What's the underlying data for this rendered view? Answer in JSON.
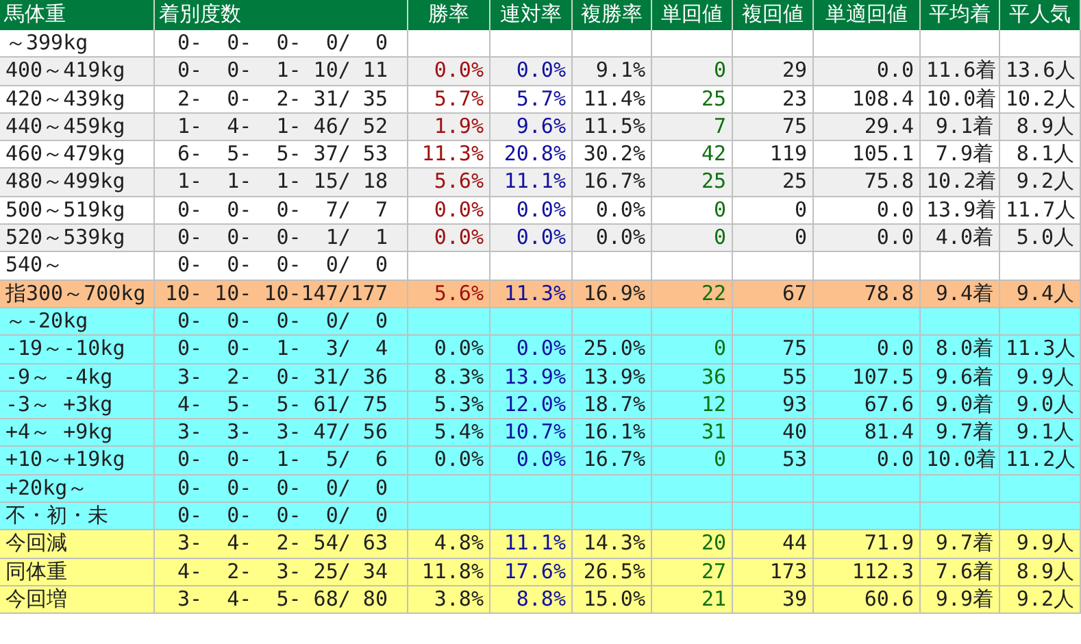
{
  "table": {
    "columns": [
      "馬体重",
      "着別度数",
      "勝率",
      "連対率",
      "複勝率",
      "単回値",
      "複回値",
      "単適回値",
      "平均着",
      "平人気"
    ],
    "rows": [
      {
        "kind": "weight",
        "cells": [
          "～399kg",
          "0-  0-  0-  0/  0",
          null,
          null,
          null,
          null,
          null,
          null,
          null,
          null
        ]
      },
      {
        "kind": "weight",
        "cells": [
          "400～419kg",
          "0-  0-  1- 10/ 11",
          "0.0%",
          "0.0%",
          "9.1%",
          "0",
          "29",
          "0.0",
          "11.6着",
          "13.6人"
        ]
      },
      {
        "kind": "weight",
        "cells": [
          "420～439kg",
          "2-  0-  2- 31/ 35",
          "5.7%",
          "5.7%",
          "11.4%",
          "25",
          "23",
          "108.4",
          "10.0着",
          "10.2人"
        ]
      },
      {
        "kind": "weight",
        "cells": [
          "440～459kg",
          "1-  4-  1- 46/ 52",
          "1.9%",
          "9.6%",
          "11.5%",
          "7",
          "75",
          "29.4",
          "9.1着",
          "8.9人"
        ]
      },
      {
        "kind": "weight",
        "cells": [
          "460～479kg",
          "6-  5-  5- 37/ 53",
          "11.3%",
          "20.8%",
          "30.2%",
          "42",
          "119",
          "105.1",
          "7.9着",
          "8.1人"
        ]
      },
      {
        "kind": "weight",
        "cells": [
          "480～499kg",
          "1-  1-  1- 15/ 18",
          "5.6%",
          "11.1%",
          "16.7%",
          "25",
          "25",
          "75.8",
          "10.2着",
          "9.2人"
        ]
      },
      {
        "kind": "weight",
        "cells": [
          "500～519kg",
          "0-  0-  0-  7/  7",
          "0.0%",
          "0.0%",
          "0.0%",
          "0",
          "0",
          "0.0",
          "13.9着",
          "11.7人"
        ]
      },
      {
        "kind": "weight",
        "cells": [
          "520～539kg",
          "0-  0-  0-  1/  1",
          "0.0%",
          "0.0%",
          "0.0%",
          "0",
          "0",
          "0.0",
          "4.0着",
          "5.0人"
        ]
      },
      {
        "kind": "weight",
        "cells": [
          "540～",
          "0-  0-  0-  0/  0",
          null,
          null,
          null,
          null,
          null,
          null,
          null,
          null
        ]
      },
      {
        "kind": "total",
        "cells": [
          "指300～700kg",
          "10- 10- 10-147/177",
          "5.6%",
          "11.3%",
          "16.9%",
          "22",
          "67",
          "78.8",
          "9.4着",
          "9.4人"
        ]
      },
      {
        "kind": "change",
        "cells": [
          "～-20kg",
          "0-  0-  0-  0/  0",
          null,
          null,
          null,
          null,
          null,
          null,
          null,
          null
        ]
      },
      {
        "kind": "change",
        "cells": [
          "-19～-10kg",
          "0-  0-  1-  3/  4",
          "0.0%",
          "0.0%",
          "25.0%",
          "0",
          "75",
          "0.0",
          "8.0着",
          "11.3人"
        ]
      },
      {
        "kind": "change",
        "cells": [
          "-9～ -4kg",
          "3-  2-  0- 31/ 36",
          "8.3%",
          "13.9%",
          "13.9%",
          "36",
          "55",
          "107.5",
          "9.6着",
          "9.9人"
        ]
      },
      {
        "kind": "change",
        "cells": [
          "-3～ +3kg",
          "4-  5-  5- 61/ 75",
          "5.3%",
          "12.0%",
          "18.7%",
          "12",
          "93",
          "67.6",
          "9.0着",
          "9.0人"
        ]
      },
      {
        "kind": "change",
        "cells": [
          "+4～ +9kg",
          "3-  3-  3- 47/ 56",
          "5.4%",
          "10.7%",
          "16.1%",
          "31",
          "40",
          "81.4",
          "9.7着",
          "9.1人"
        ]
      },
      {
        "kind": "change",
        "cells": [
          "+10～+19kg",
          "0-  0-  1-  5/  6",
          "0.0%",
          "0.0%",
          "16.7%",
          "0",
          "53",
          "0.0",
          "10.0着",
          "11.2人"
        ]
      },
      {
        "kind": "change",
        "cells": [
          "+20kg～",
          "0-  0-  0-  0/  0",
          null,
          null,
          null,
          null,
          null,
          null,
          null,
          null
        ]
      },
      {
        "kind": "change",
        "cells": [
          "不・初・未",
          "0-  0-  0-  0/  0",
          null,
          null,
          null,
          null,
          null,
          null,
          null,
          null
        ]
      },
      {
        "kind": "compare",
        "cells": [
          "今回減",
          "3-  4-  2- 54/ 63",
          "4.8%",
          "11.1%",
          "14.3%",
          "20",
          "44",
          "71.9",
          "9.7着",
          "9.9人"
        ]
      },
      {
        "kind": "compare",
        "cells": [
          "同体重",
          "4-  2-  3- 25/ 34",
          "11.8%",
          "17.6%",
          "26.5%",
          "27",
          "173",
          "112.3",
          "7.6着",
          "8.9人"
        ]
      },
      {
        "kind": "compare",
        "cells": [
          "今回増",
          "3-  4-  5- 68/ 80",
          "3.8%",
          "8.8%",
          "15.0%",
          "21",
          "39",
          "60.6",
          "9.9着",
          "9.2人"
        ]
      }
    ]
  }
}
